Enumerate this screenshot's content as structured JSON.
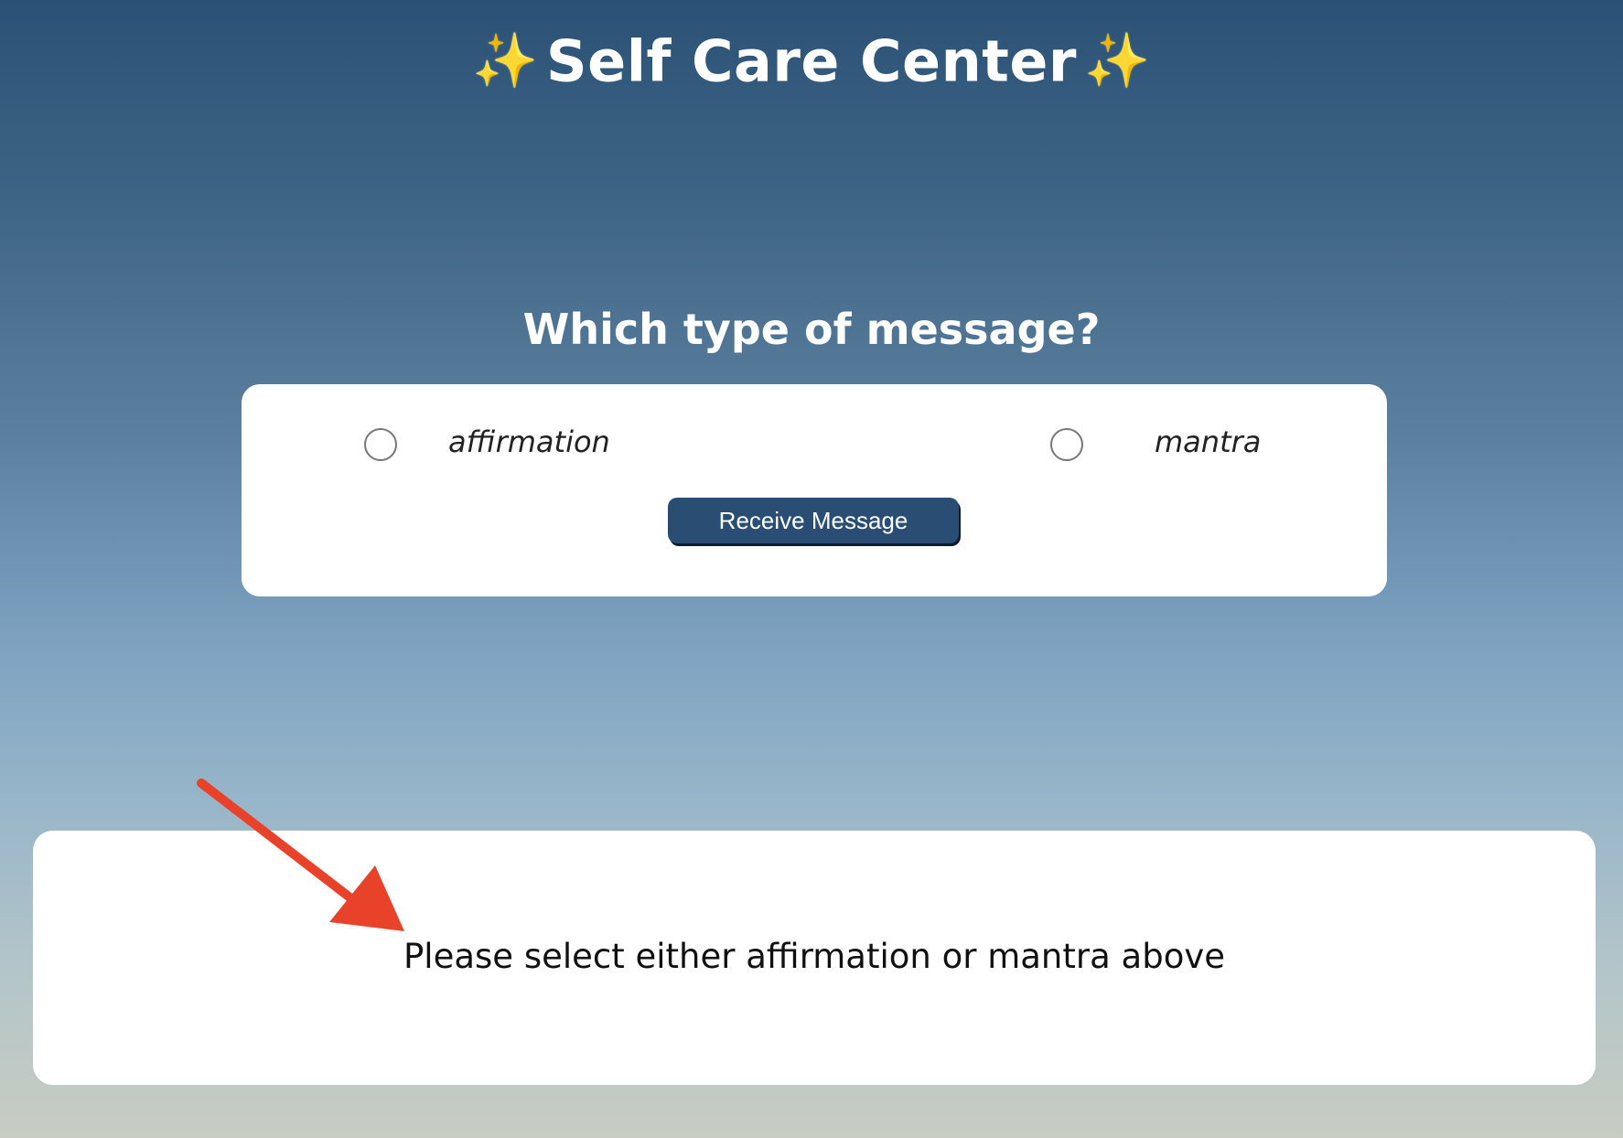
{
  "header": {
    "title": "Self Care Center",
    "sparkle_icon": "sparkles-icon",
    "sparkle_color": "#f7d44a"
  },
  "question": {
    "text": "Which type of message?"
  },
  "options": [
    {
      "label": "affirmation",
      "selected": false
    },
    {
      "label": "mantra",
      "selected": false
    }
  ],
  "receive_button": {
    "label": "Receive Message",
    "color": "#2a4e73"
  },
  "message": {
    "text": "Please select either affirmation or mantra above"
  },
  "annotation": {
    "arrow_color": "#e8422a",
    "icon": "arrow-icon"
  }
}
